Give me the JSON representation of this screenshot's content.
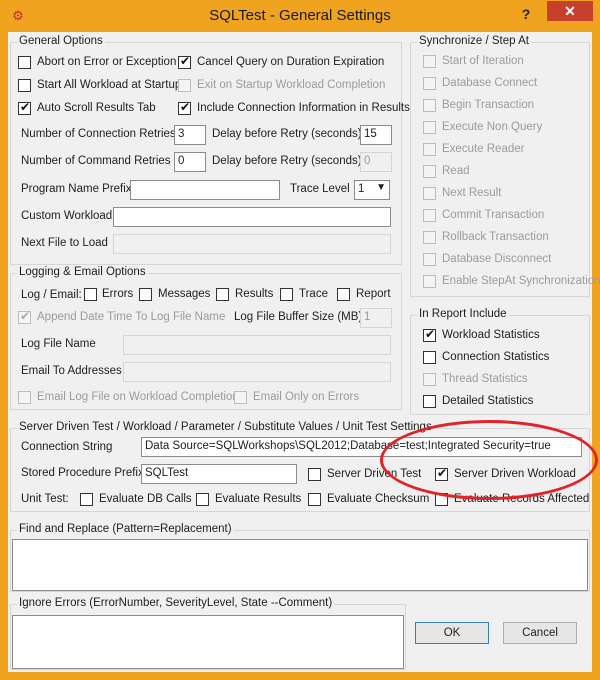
{
  "window": {
    "title": "SQLTest - General Settings",
    "help_glyph": "?",
    "close_glyph": "✕",
    "app_icon_glyph": "⚙"
  },
  "general": {
    "label": "General Options",
    "abort_on_error": "Abort on Error or Exception",
    "cancel_query": "Cancel Query on Duration Expiration",
    "start_all_workload": "Start All Workload at Startup",
    "exit_on_startup": "Exit on Startup Workload Completion",
    "auto_scroll": "Auto Scroll Results Tab",
    "include_connection_info": "Include Connection Information in Results",
    "num_connection_retries_label": "Number of Connection Retries",
    "num_connection_retries": "3",
    "delay_before_retry_label": "Delay before Retry (seconds)",
    "delay_before_retry": "15",
    "num_command_retries_label": "Number of Command Retries",
    "num_command_retries": "0",
    "delay_before_retry2_label": "Delay before Retry (seconds)",
    "delay_before_retry2": "0",
    "program_name_prefix_label": "Program Name Prefix",
    "program_name_prefix": "",
    "trace_level_label": "Trace Level",
    "trace_level": "1",
    "custom_workload_label": "Custom Workload",
    "custom_workload": "",
    "next_file_label": "Next File to Load",
    "next_file": ""
  },
  "sync": {
    "label": "Synchronize / Step At",
    "items": [
      "Start of Iteration",
      "Database Connect",
      "Begin Transaction",
      "Execute Non Query",
      "Execute Reader",
      "Read",
      "Next Result",
      "Commit Transaction",
      "Rollback Transaction",
      "Database Disconnect",
      "Enable StepAt Synchronization"
    ]
  },
  "logging": {
    "label": "Logging & Email Options",
    "log_email_label": "Log / Email:",
    "errors": "Errors",
    "messages": "Messages",
    "results": "Results",
    "trace": "Trace",
    "report": "Report",
    "append_date": "Append Date Time To Log File Name",
    "log_buffer_label": "Log File Buffer Size (MB)",
    "log_buffer": "1",
    "log_file_name_label": "Log File Name",
    "log_file_name": "",
    "email_to_label": "Email To Addresses",
    "email_to": "",
    "email_log_file": "Email Log File on Workload Completion",
    "email_only_errors": "Email Only on Errors"
  },
  "report": {
    "label": "In Report Include",
    "workload_stats": "Workload Statistics",
    "connection_stats": "Connection Statistics",
    "thread_stats": "Thread Statistics",
    "detailed_stats": "Detailed Statistics"
  },
  "server": {
    "label": "Server Driven Test / Workload / Parameter / Substitute Values / Unit Test Settings",
    "connection_string_label": "Connection String",
    "connection_string": "Data Source=SQLWorkshops\\SQL2012;Database=test;Integrated Security=true",
    "stored_proc_prefix_label": "Stored Procedure Prefix",
    "stored_proc_prefix": "SQLTest",
    "server_driven_test": "Server Driven Test",
    "server_driven_workload": "Server Driven Workload",
    "unit_test_label": "Unit Test:",
    "evaluate_db_calls": "Evaluate DB Calls",
    "evaluate_results": "Evaluate Results",
    "evaluate_checksum": "Evaluate Checksum",
    "evaluate_records_affected": "Evaluate Records Affected"
  },
  "find_replace": {
    "label": "Find and Replace (Pattern=Replacement)"
  },
  "ignore_errors": {
    "label": "Ignore Errors (ErrorNumber, SeverityLevel, State --Comment)"
  },
  "buttons": {
    "ok": "OK",
    "cancel": "Cancel"
  },
  "colors": {
    "title_bar": "#f0a31e",
    "close_button": "#c7402e",
    "highlight_oval": "#e0242a"
  }
}
